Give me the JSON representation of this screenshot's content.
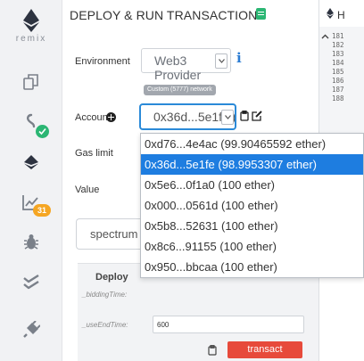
{
  "sidebar": {
    "logo_text": "remix",
    "badge_count": "31"
  },
  "panel": {
    "title": "DEPLOY & RUN TRANSACTIONS",
    "environment_label": "Environment",
    "environment_value": "Web3 Provider",
    "network_badge": "Custom (5777) network",
    "account_label": "Account",
    "account_value": "0x36d...5e1fe (98.9953307 ether)",
    "gas_limit_label": "Gas limit",
    "value_label": "Value",
    "contract_search_value": "spectrum"
  },
  "deploy": {
    "title": "Deploy",
    "param1_label": "_biddingTime:",
    "param2_label": "_useEndTime:",
    "param2_value": "600",
    "transact_label": "transact"
  },
  "accounts_dropdown": [
    "0xd76...4e4ac (99.90465592 ether)",
    "0x36d...5e1fe (98.9953307 ether)",
    "0x5e6...0f1a0 (100 ether)",
    "0x000...0561d (100 ether)",
    "0x5b8...52631 (100 ether)",
    "0x8c6...91155 (100 ether)",
    "0x950...bbcaa (100 ether)"
  ],
  "selected_account_index": 1,
  "editor": {
    "tab_label": "H",
    "line_numbers": [
      "181",
      "182",
      "183",
      "184",
      "185",
      "186",
      "187",
      "188"
    ]
  },
  "colors": {
    "accent_blue": "#1e7de0",
    "transact_red": "#e74a3b",
    "success_green": "#2bb673",
    "badge_orange": "#f5a623"
  }
}
